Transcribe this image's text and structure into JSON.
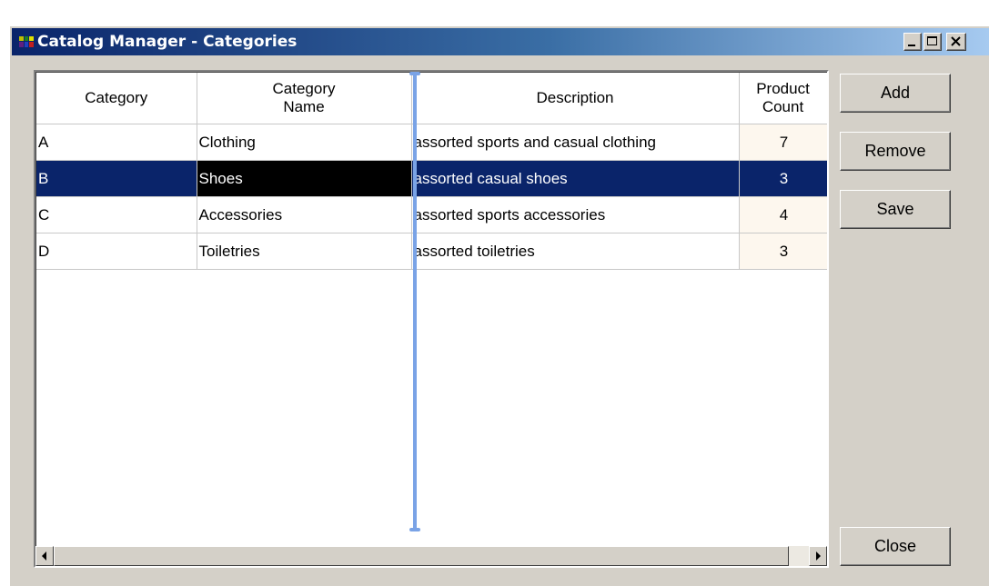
{
  "window": {
    "title": "Catalog Manager - Categories",
    "app_icon": "catalog-app-icon",
    "controls": {
      "minimize": "minimize-icon",
      "maximize": "maximize-icon",
      "close": "close-icon"
    }
  },
  "grid": {
    "columns": [
      {
        "key": "category",
        "label": "Category"
      },
      {
        "key": "name",
        "label": "Category\nName"
      },
      {
        "key": "description",
        "label": "Description"
      },
      {
        "key": "count",
        "label": "Product\nCount"
      }
    ],
    "rows": [
      {
        "category": "A",
        "name": "Clothing",
        "description": "assorted sports and casual clothing",
        "count": "7",
        "selected": false
      },
      {
        "category": "B",
        "name": "Shoes",
        "description": "assorted casual shoes",
        "count": "3",
        "selected": true
      },
      {
        "category": "C",
        "name": "Accessories",
        "description": "assorted sports accessories",
        "count": "4",
        "selected": false
      },
      {
        "category": "D",
        "name": "Toiletries",
        "description": "assorted toiletries",
        "count": "3",
        "selected": false
      }
    ],
    "selected_row_color": "#0a246a",
    "editing_cell_color": "#000000",
    "count_cell_color": "#fdf7ee",
    "resize_line_color": "#7aa3e6"
  },
  "buttons": {
    "add": "Add",
    "remove": "Remove",
    "save": "Save",
    "close": "Close"
  }
}
